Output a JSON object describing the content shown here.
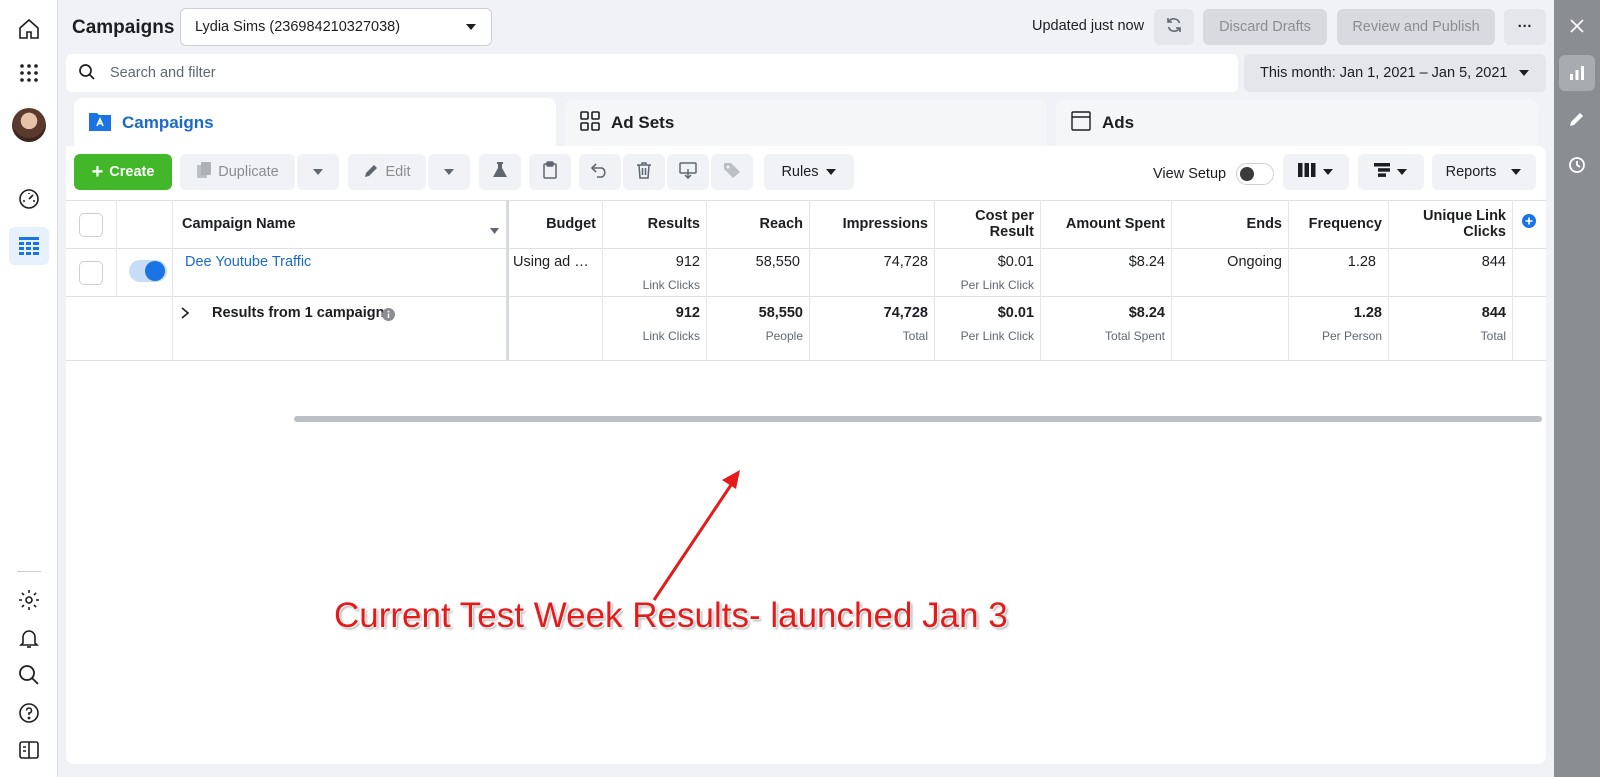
{
  "header": {
    "title": "Campaigns",
    "account": "Lydia Sims (236984210327038)",
    "updated": "Updated just now",
    "discard_label": "Discard Drafts",
    "publish_label": "Review and Publish",
    "more_label": "···"
  },
  "search": {
    "placeholder": "Search and filter",
    "date_range": "This month: Jan 1, 2021 – Jan 5, 2021"
  },
  "tabs": [
    {
      "label": "Campaigns"
    },
    {
      "label": "Ad Sets"
    },
    {
      "label": "Ads"
    }
  ],
  "toolbar": {
    "create_label": "Create",
    "duplicate_label": "Duplicate",
    "edit_label": "Edit",
    "rules_label": "Rules",
    "view_setup_label": "View Setup",
    "reports_label": "Reports"
  },
  "table": {
    "columns": {
      "name": "Campaign Name",
      "budget": "Budget",
      "results": "Results",
      "reach": "Reach",
      "impressions": "Impressions",
      "cost_per_result_1": "Cost per",
      "cost_per_result_2": "Result",
      "amount_spent": "Amount Spent",
      "ends": "Ends",
      "frequency": "Frequency",
      "unique_link_clicks_1": "Unique Link",
      "unique_link_clicks_2": "Clicks"
    },
    "row": {
      "name": "Dee Youtube Traffic",
      "budget": "Using ad …",
      "results": "912",
      "results_sub": "Link Clicks",
      "reach": "58,550",
      "impressions": "74,728",
      "cost_per_result": "$0.01",
      "cost_sub": "Per Link Click",
      "amount_spent": "$8.24",
      "ends": "Ongoing",
      "frequency": "1.28",
      "unique_link_clicks": "844"
    },
    "summary": {
      "label": "Results from 1 campaign",
      "results": "912",
      "results_sub": "Link Clicks",
      "reach": "58,550",
      "reach_sub": "People",
      "impressions": "74,728",
      "impressions_sub": "Total",
      "cost_per_result": "$0.01",
      "cost_sub": "Per Link Click",
      "amount_spent": "$8.24",
      "amount_sub": "Total Spent",
      "frequency": "1.28",
      "frequency_sub": "Per Person",
      "unique_link_clicks": "844",
      "unique_sub": "Total"
    }
  },
  "annotation": {
    "text": "Current Test Week Results- launched Jan 3",
    "color": "#e31b1b"
  },
  "colors": {
    "accent": "#1b74e4",
    "create": "#42b72a"
  }
}
